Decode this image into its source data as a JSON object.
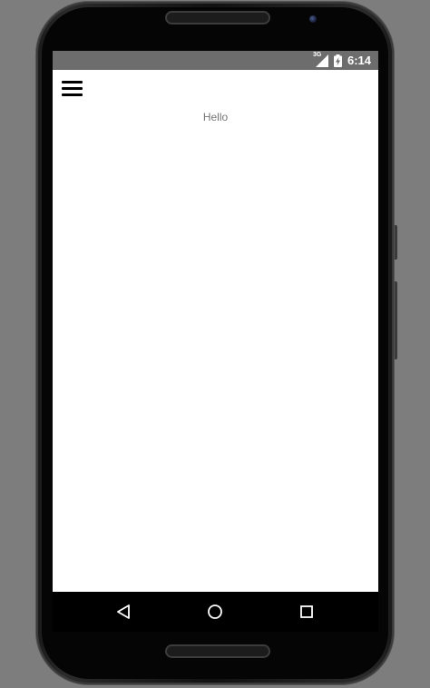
{
  "status_bar": {
    "network": "3G",
    "time": "6:14",
    "background_color": "#6d6d6d"
  },
  "app": {
    "menu_icon": "hamburger-menu-icon",
    "greeting": "Hello",
    "background_color": "#ffffff",
    "text_color": "#757575"
  },
  "nav_bar": {
    "back_icon": "back-triangle-icon",
    "home_icon": "home-circle-icon",
    "recents_icon": "recents-square-icon"
  }
}
